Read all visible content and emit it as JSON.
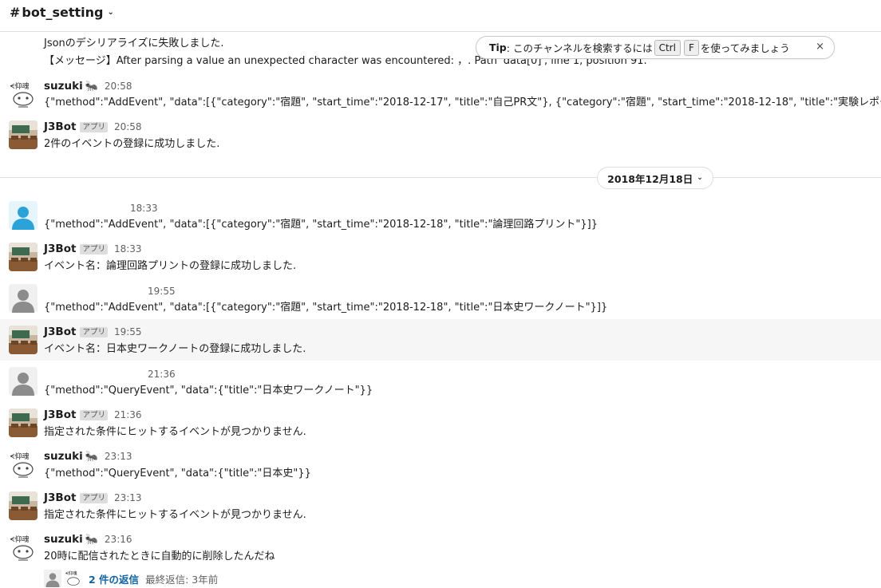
{
  "header": {
    "hash": "#",
    "channel": "bot_setting"
  },
  "tip": {
    "label": "Tip",
    "text_pre": ": このチャンネルを検索するには",
    "key1": "Ctrl",
    "key2": "F",
    "text_post": "を使ってみましょう",
    "close": "×"
  },
  "top_message": {
    "line1": "Jsonのデシリアライズに失敗しました.",
    "line2": "【メッセージ】After parsing a value an unexpected character was encountered: ，. Path 'data[0]', line 1, position 91."
  },
  "date_divider": {
    "label": "2018年12月18日"
  },
  "messages": [
    {
      "name": "suzuki",
      "badge": "",
      "time": "20:58",
      "text": "{\"method\":\"AddEvent\", \"data\":[{\"category\":\"宿題\", \"start_time\":\"2018-12-17\", \"title\":\"自己PR文\"}, {\"category\":\"宿題\", \"start_time\":\"2018-12-18\", \"title\":\"実験レポート\"}]}"
    },
    {
      "name": "J3Bot",
      "badge": "アプリ",
      "time": "20:58",
      "text": "2件のイベントの登録に成功しました."
    },
    {
      "name": "",
      "badge": "",
      "time": "18:33",
      "text": "{\"method\":\"AddEvent\", \"data\":[{\"category\":\"宿題\", \"start_time\":\"2018-12-18\", \"title\":\"論理回路プリント\"}]}"
    },
    {
      "name": "J3Bot",
      "badge": "アプリ",
      "time": "18:33",
      "text": "イベント名：論理回路プリントの登録に成功しました."
    },
    {
      "name": "",
      "badge": "",
      "time": "19:55",
      "text": "{\"method\":\"AddEvent\", \"data\":[{\"category\":\"宿題\", \"start_time\":\"2018-12-18\", \"title\":\"日本史ワークノート\"}]}"
    },
    {
      "name": "J3Bot",
      "badge": "アプリ",
      "time": "19:55",
      "text": "イベント名：日本史ワークノートの登録に成功しました."
    },
    {
      "name": "",
      "badge": "",
      "time": "21:36",
      "text": "{\"method\":\"QueryEvent\", \"data\":{\"title\":\"日本史ワークノート\"}}"
    },
    {
      "name": "J3Bot",
      "badge": "アプリ",
      "time": "21:36",
      "text": "指定された条件にヒットするイベントが見つかりません."
    },
    {
      "name": "suzuki",
      "badge": "",
      "time": "23:13",
      "text": "{\"method\":\"QueryEvent\", \"data\":{\"title\":\"日本史\"}}"
    },
    {
      "name": "J3Bot",
      "badge": "アプリ",
      "time": "23:13",
      "text": "指定された条件にヒットするイベントが見つかりません."
    },
    {
      "name": "suzuki",
      "badge": "",
      "time": "23:16",
      "text": "20時に配信されたときに自動的に削除したんだね"
    }
  ],
  "thread": {
    "replies": "2 件の返信",
    "last_reply": "最終返信: 3年前"
  },
  "colors": {
    "link": "#1264a3",
    "divider": "#dddddd",
    "hover_row": "#f6f6f6",
    "avatar_blue": "#2ba3d8",
    "avatar_gray": "#8c8c8c"
  }
}
